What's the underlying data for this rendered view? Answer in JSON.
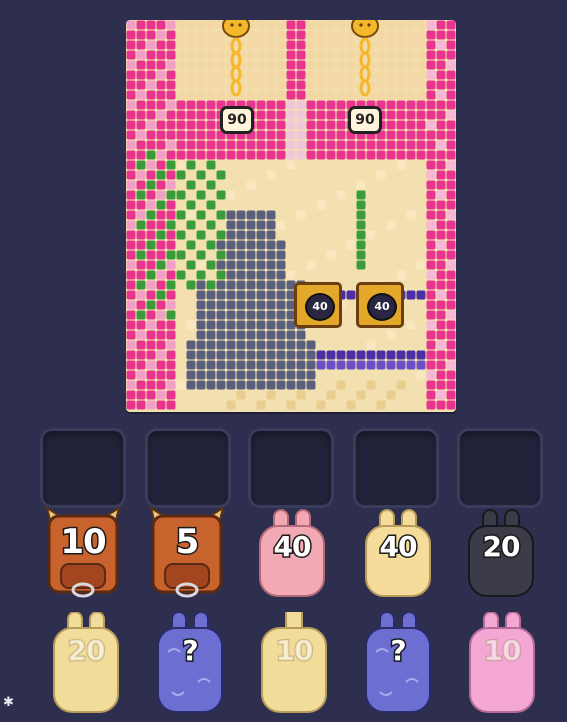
{
  "board": {
    "locks_top": [
      {
        "value": "90"
      },
      {
        "value": "90"
      }
    ],
    "locks_mid": [
      {
        "value": "40"
      },
      {
        "value": "40"
      }
    ]
  },
  "slots_count": 5,
  "queue_front": [
    {
      "value": "10",
      "kind": "bull"
    },
    {
      "value": "5",
      "kind": "bull"
    },
    {
      "value": "40",
      "kind": "bunny",
      "color": "#f3a9b4"
    },
    {
      "value": "40",
      "kind": "bunny",
      "color": "#f6dc9b"
    },
    {
      "value": "20",
      "kind": "bunny",
      "color": "#3c3c48"
    }
  ],
  "queue_back": [
    {
      "value": "20",
      "kind": "bunny",
      "color": "#f2dc9a"
    },
    {
      "value": "?",
      "kind": "mystery",
      "color": "#6c6fd1"
    },
    {
      "value": "10",
      "kind": "bunny",
      "color": "#f2dc9a"
    },
    {
      "value": "?",
      "kind": "mystery",
      "color": "#6c6fd1"
    },
    {
      "value": "10",
      "kind": "bunny",
      "color": "#f5a7d4"
    }
  ],
  "colors": {
    "background": "#2e2f4f",
    "pink": "#e8348f",
    "cream": "#f3e0b0",
    "cat": "#5b5f7e",
    "purple": "#4b2fa6",
    "green": "#3a9b3a",
    "gold": "#e3a72a"
  },
  "icons": [
    "chain-lock-icon",
    "gear-icon",
    "bull-icon",
    "bunny-icon"
  ]
}
